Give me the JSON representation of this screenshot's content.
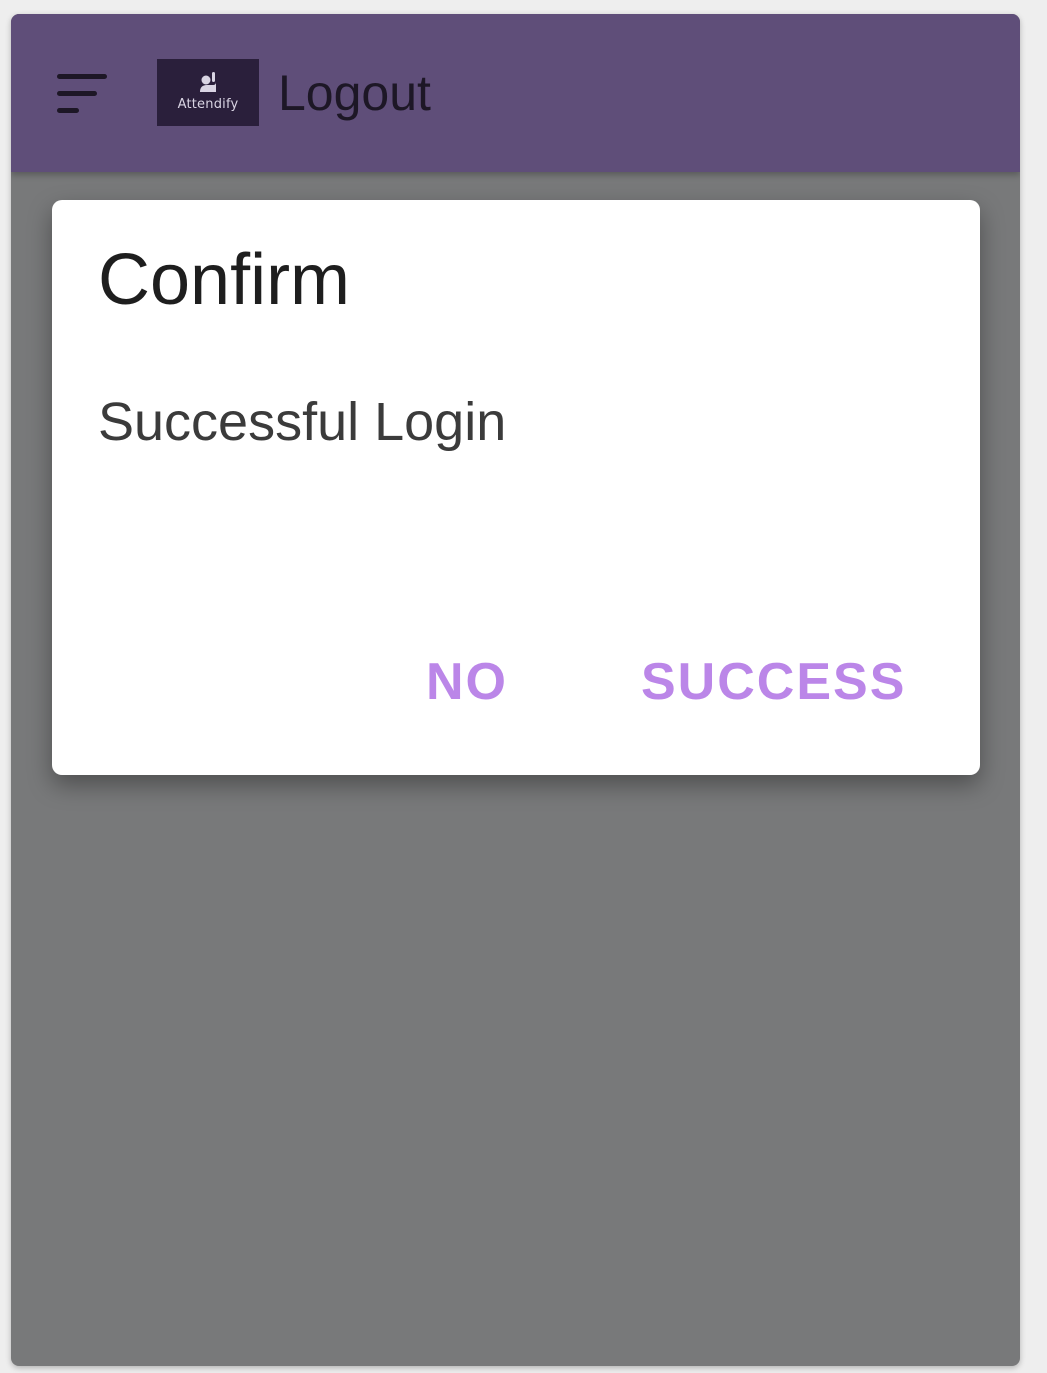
{
  "app_bar": {
    "title": "Logout",
    "logo_text": "Attendify",
    "menu_icon": "menu-sort-icon",
    "background": "#5f4e79"
  },
  "dialog": {
    "title": "Confirm",
    "message": "Successful Login",
    "buttons": {
      "no_label": "NO",
      "success_label": "SUCCESS"
    },
    "accent": "#bb86e8"
  },
  "scrim_color": "#78797a"
}
